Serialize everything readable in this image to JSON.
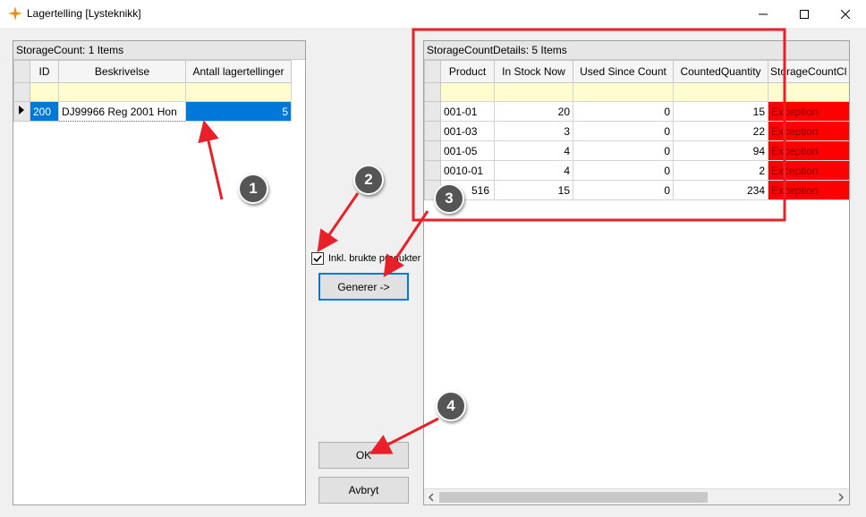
{
  "window": {
    "title": "Lagertelling [Lysteknikk]",
    "icon": "orange-star-icon",
    "controls": [
      "minimize",
      "maximize",
      "close"
    ]
  },
  "left_grid": {
    "header": "StorageCount: 1 Items",
    "columns": [
      "ID",
      "Beskrivelse",
      "Antall lagertellinger"
    ],
    "rows": [
      {
        "id": "200",
        "description": "DJ99966 Reg 2001 Hon",
        "count": "5"
      }
    ]
  },
  "middle": {
    "checkbox_label": "Inkl. brukte produkter",
    "checkbox_checked": true,
    "generate_button": "Generer ->",
    "ok_button": "OK",
    "cancel_button": "Avbryt"
  },
  "right_grid": {
    "header": "StorageCountDetails: 5 Items",
    "columns": [
      "Product",
      "In Stock Now",
      "Used Since Count",
      "CountedQuantity",
      "StorageCountCl"
    ],
    "rows": [
      {
        "product": "001-01",
        "in_stock": "20",
        "used": "0",
        "counted": "15",
        "status": "Exception"
      },
      {
        "product": "001-03",
        "in_stock": "3",
        "used": "0",
        "counted": "22",
        "status": "Exception"
      },
      {
        "product": "001-05",
        "in_stock": "4",
        "used": "0",
        "counted": "94",
        "status": "Exception"
      },
      {
        "product": "0010-01",
        "in_stock": "4",
        "used": "0",
        "counted": "2",
        "status": "Exception"
      },
      {
        "product": "516",
        "in_stock": "15",
        "used": "0",
        "counted": "234",
        "status": "Exception"
      }
    ]
  },
  "annotations": [
    "1",
    "2",
    "3",
    "4"
  ],
  "colors": {
    "selection": "#0078d7",
    "filter_row": "#fffdd0",
    "exception": "#ff0000",
    "annotation_arrow": "#e8202a",
    "annotation_badge": "#555555",
    "highlight_box": "#e8202a"
  }
}
